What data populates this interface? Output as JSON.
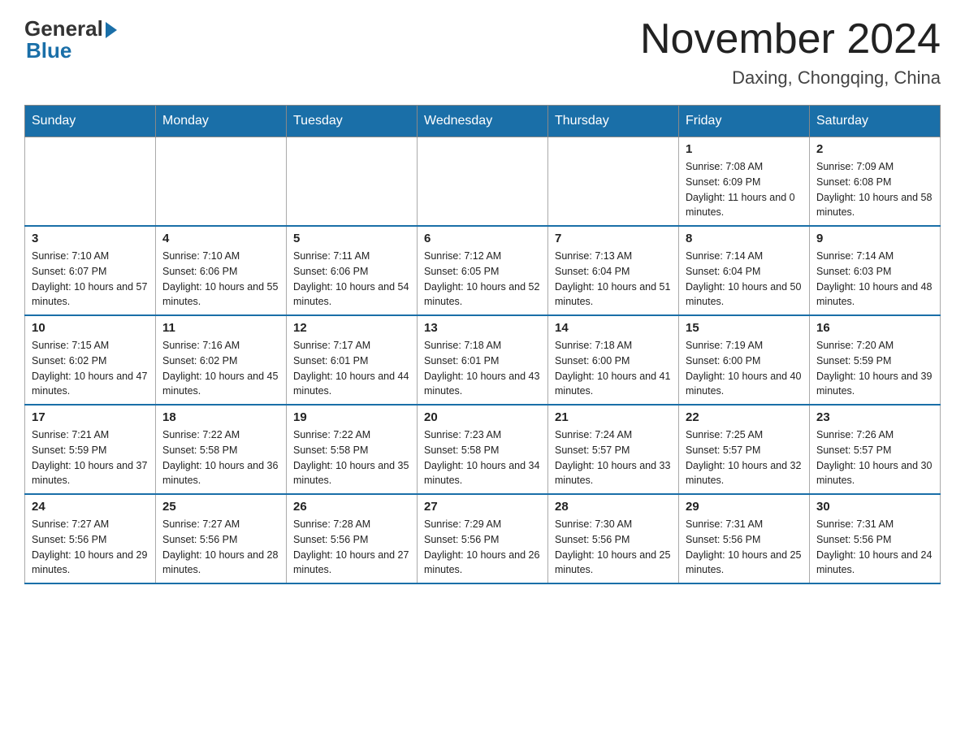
{
  "logo": {
    "general_text": "General",
    "blue_text": "Blue"
  },
  "title": "November 2024",
  "subtitle": "Daxing, Chongqing, China",
  "days_of_week": [
    "Sunday",
    "Monday",
    "Tuesday",
    "Wednesday",
    "Thursday",
    "Friday",
    "Saturday"
  ],
  "weeks": [
    [
      {
        "day": "",
        "info": ""
      },
      {
        "day": "",
        "info": ""
      },
      {
        "day": "",
        "info": ""
      },
      {
        "day": "",
        "info": ""
      },
      {
        "day": "",
        "info": ""
      },
      {
        "day": "1",
        "info": "Sunrise: 7:08 AM\nSunset: 6:09 PM\nDaylight: 11 hours and 0 minutes."
      },
      {
        "day": "2",
        "info": "Sunrise: 7:09 AM\nSunset: 6:08 PM\nDaylight: 10 hours and 58 minutes."
      }
    ],
    [
      {
        "day": "3",
        "info": "Sunrise: 7:10 AM\nSunset: 6:07 PM\nDaylight: 10 hours and 57 minutes."
      },
      {
        "day": "4",
        "info": "Sunrise: 7:10 AM\nSunset: 6:06 PM\nDaylight: 10 hours and 55 minutes."
      },
      {
        "day": "5",
        "info": "Sunrise: 7:11 AM\nSunset: 6:06 PM\nDaylight: 10 hours and 54 minutes."
      },
      {
        "day": "6",
        "info": "Sunrise: 7:12 AM\nSunset: 6:05 PM\nDaylight: 10 hours and 52 minutes."
      },
      {
        "day": "7",
        "info": "Sunrise: 7:13 AM\nSunset: 6:04 PM\nDaylight: 10 hours and 51 minutes."
      },
      {
        "day": "8",
        "info": "Sunrise: 7:14 AM\nSunset: 6:04 PM\nDaylight: 10 hours and 50 minutes."
      },
      {
        "day": "9",
        "info": "Sunrise: 7:14 AM\nSunset: 6:03 PM\nDaylight: 10 hours and 48 minutes."
      }
    ],
    [
      {
        "day": "10",
        "info": "Sunrise: 7:15 AM\nSunset: 6:02 PM\nDaylight: 10 hours and 47 minutes."
      },
      {
        "day": "11",
        "info": "Sunrise: 7:16 AM\nSunset: 6:02 PM\nDaylight: 10 hours and 45 minutes."
      },
      {
        "day": "12",
        "info": "Sunrise: 7:17 AM\nSunset: 6:01 PM\nDaylight: 10 hours and 44 minutes."
      },
      {
        "day": "13",
        "info": "Sunrise: 7:18 AM\nSunset: 6:01 PM\nDaylight: 10 hours and 43 minutes."
      },
      {
        "day": "14",
        "info": "Sunrise: 7:18 AM\nSunset: 6:00 PM\nDaylight: 10 hours and 41 minutes."
      },
      {
        "day": "15",
        "info": "Sunrise: 7:19 AM\nSunset: 6:00 PM\nDaylight: 10 hours and 40 minutes."
      },
      {
        "day": "16",
        "info": "Sunrise: 7:20 AM\nSunset: 5:59 PM\nDaylight: 10 hours and 39 minutes."
      }
    ],
    [
      {
        "day": "17",
        "info": "Sunrise: 7:21 AM\nSunset: 5:59 PM\nDaylight: 10 hours and 37 minutes."
      },
      {
        "day": "18",
        "info": "Sunrise: 7:22 AM\nSunset: 5:58 PM\nDaylight: 10 hours and 36 minutes."
      },
      {
        "day": "19",
        "info": "Sunrise: 7:22 AM\nSunset: 5:58 PM\nDaylight: 10 hours and 35 minutes."
      },
      {
        "day": "20",
        "info": "Sunrise: 7:23 AM\nSunset: 5:58 PM\nDaylight: 10 hours and 34 minutes."
      },
      {
        "day": "21",
        "info": "Sunrise: 7:24 AM\nSunset: 5:57 PM\nDaylight: 10 hours and 33 minutes."
      },
      {
        "day": "22",
        "info": "Sunrise: 7:25 AM\nSunset: 5:57 PM\nDaylight: 10 hours and 32 minutes."
      },
      {
        "day": "23",
        "info": "Sunrise: 7:26 AM\nSunset: 5:57 PM\nDaylight: 10 hours and 30 minutes."
      }
    ],
    [
      {
        "day": "24",
        "info": "Sunrise: 7:27 AM\nSunset: 5:56 PM\nDaylight: 10 hours and 29 minutes."
      },
      {
        "day": "25",
        "info": "Sunrise: 7:27 AM\nSunset: 5:56 PM\nDaylight: 10 hours and 28 minutes."
      },
      {
        "day": "26",
        "info": "Sunrise: 7:28 AM\nSunset: 5:56 PM\nDaylight: 10 hours and 27 minutes."
      },
      {
        "day": "27",
        "info": "Sunrise: 7:29 AM\nSunset: 5:56 PM\nDaylight: 10 hours and 26 minutes."
      },
      {
        "day": "28",
        "info": "Sunrise: 7:30 AM\nSunset: 5:56 PM\nDaylight: 10 hours and 25 minutes."
      },
      {
        "day": "29",
        "info": "Sunrise: 7:31 AM\nSunset: 5:56 PM\nDaylight: 10 hours and 25 minutes."
      },
      {
        "day": "30",
        "info": "Sunrise: 7:31 AM\nSunset: 5:56 PM\nDaylight: 10 hours and 24 minutes."
      }
    ]
  ]
}
